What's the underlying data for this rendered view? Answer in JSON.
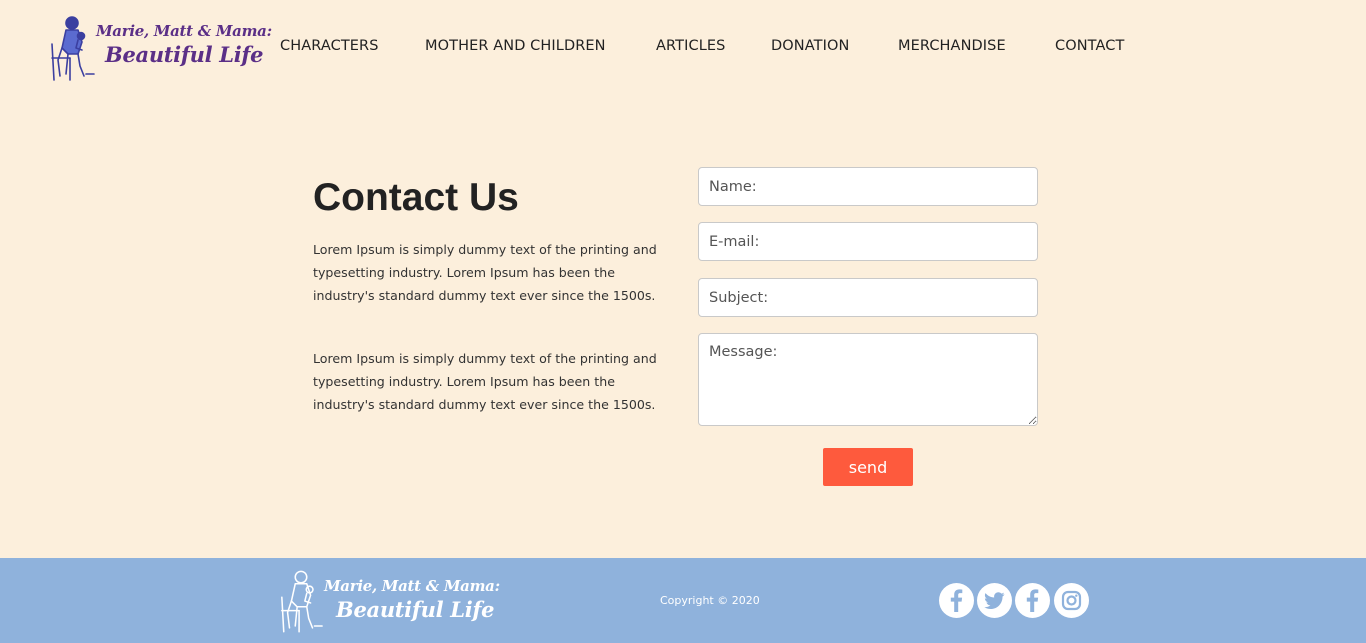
{
  "brand": {
    "line1": "Marie, Matt & Mama:",
    "line2": "Beautiful Life"
  },
  "nav": {
    "items": [
      {
        "label": "CHARACTERS"
      },
      {
        "label": "MOTHER AND CHILDREN"
      },
      {
        "label": "ARTICLES"
      },
      {
        "label": "DONATION"
      },
      {
        "label": "MERCHANDISE"
      },
      {
        "label": "CONTACT"
      }
    ]
  },
  "contact": {
    "title": "Contact Us",
    "paragraphs": [
      "Lorem Ipsum is simply dummy text of the printing and typesetting industry. Lorem Ipsum has been the industry's standard dummy text ever since the 1500s.",
      "Lorem Ipsum is simply dummy text of the printing and typesetting industry. Lorem Ipsum has been the industry's standard dummy text ever since the 1500s."
    ],
    "form": {
      "name_placeholder": "Name:",
      "email_placeholder": "E-mail:",
      "subject_placeholder": "Subject:",
      "message_placeholder": "Message:",
      "send_label": "send"
    }
  },
  "footer": {
    "copyright": "Copyright © 2020",
    "social": [
      "facebook-icon",
      "twitter-icon",
      "facebook-icon",
      "instagram-icon"
    ]
  },
  "colors": {
    "page_background": "#fcefdc",
    "brand_purple": "#5b2f87",
    "send_button": "#fe5a3d",
    "footer_background": "#8fb2dc"
  }
}
